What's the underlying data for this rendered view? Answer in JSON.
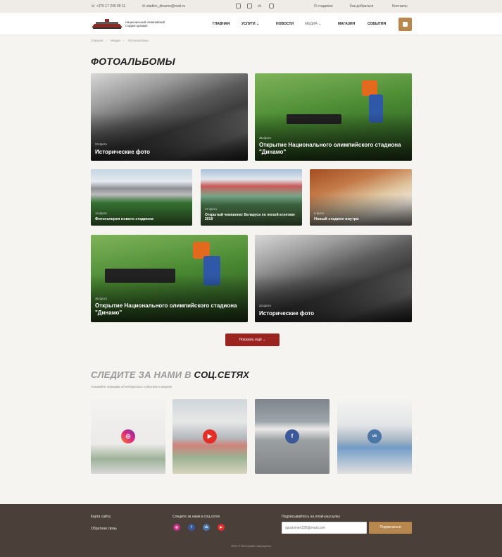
{
  "topbar": {
    "phone": "+375 17 240 09 11",
    "email": "stadion_dinamo@mail.ru",
    "links": [
      "О стадионе",
      "Как добраться",
      "Контакты"
    ],
    "social_icons": [
      "instagram-icon",
      "facebook-icon",
      "vk-icon",
      "youtube-icon"
    ]
  },
  "header": {
    "logo_text": "Национальный олимпийский стадион динамо",
    "nav": [
      "Главная",
      "Услуги",
      "Новости",
      "Медиа",
      "Магазин",
      "События"
    ]
  },
  "breadcrumbs": [
    "Главная",
    "Медиа",
    "Фотоальбомы"
  ],
  "page_title": "ФОТОАЛЬБОМЫ",
  "albums": [
    {
      "count": "24 фото",
      "title": "Исторические фото"
    },
    {
      "count": "35 фото",
      "title": "Открытие Национального олимпийского стадиона \"Динамо\""
    },
    {
      "count": "14 фото",
      "title": "Фотогалерея нового стадиона"
    },
    {
      "count": "17 фото",
      "title": "Открытый чемпионат Беларуси по легкой атлетике 2018"
    },
    {
      "count": "6 фото",
      "title": "Новый стадион внутри"
    },
    {
      "count": "35 фото",
      "title": "Открытие Национального олимпийского стадиона \"Динамо\""
    },
    {
      "count": "24 фото",
      "title": "Исторические фото"
    }
  ],
  "show_more": "Показать ещё",
  "social": {
    "title_light": "СЛЕДИТЕ ЗА НАМИ В",
    "title_bold": "СОЦ.СЕТЯХ",
    "subtitle": "Узнавайте первыми об интересных событиях и акциях!",
    "badges": [
      "instagram",
      "youtube",
      "facebook",
      "vk"
    ]
  },
  "footer": {
    "sitemap": "Карта сайта",
    "feedback": "Обратная связь",
    "follow": "Следите за нами в соц.сетях",
    "subscribe_label": "Подписывайтесь на email-рассылку",
    "email_placeholder": "sportsmen228@mail.com",
    "subscribe_button": "Подписаться",
    "copyright": "2021 © Все права защищены"
  },
  "colors": {
    "accent": "#b8874d",
    "button_red": "#9b2320",
    "footer_bg": "#4a3f39",
    "instagram": "#c13584",
    "youtube": "#e52d27",
    "facebook": "#3b5998",
    "vk": "#4a76a8"
  }
}
